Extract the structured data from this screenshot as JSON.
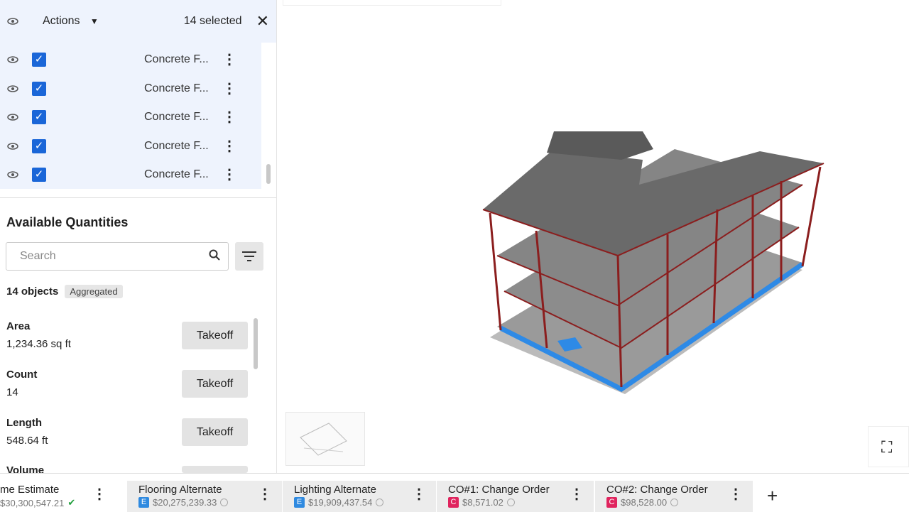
{
  "selection": {
    "actions_label": "Actions",
    "selected_count": "14 selected"
  },
  "rows": [
    {
      "name": "Concrete F..."
    },
    {
      "name": "Concrete F..."
    },
    {
      "name": "Concrete F..."
    },
    {
      "name": "Concrete F..."
    },
    {
      "name": "Concrete F..."
    }
  ],
  "quantities": {
    "title": "Available Quantities",
    "search_placeholder": "Search",
    "objects_count": "14 objects",
    "aggregated_badge": "Aggregated",
    "items": [
      {
        "label": "Area",
        "value": "1,234.36 sq ft",
        "button": "Takeoff"
      },
      {
        "label": "Count",
        "value": "14",
        "button": "Takeoff"
      },
      {
        "label": "Length",
        "value": "548.64 ft",
        "button": "Takeoff"
      },
      {
        "label": "Volume",
        "value": "",
        "button": ""
      }
    ]
  },
  "tabs": [
    {
      "title": "me Estimate",
      "amount": "$30,300,547.21",
      "type": "",
      "status": "complete"
    },
    {
      "title": "Flooring Alternate",
      "amount": "$20,275,239.33",
      "type": "E",
      "status": "pending"
    },
    {
      "title": "Lighting Alternate",
      "amount": "$19,909,437.54",
      "type": "E",
      "status": "pending"
    },
    {
      "title": "CO#1: Change Order",
      "amount": "$8,571.02",
      "type": "C",
      "status": "pending"
    },
    {
      "title": "CO#2: Change Order",
      "amount": "$98,528.00",
      "type": "C",
      "status": "pending"
    }
  ],
  "add_tab_label": "+",
  "colors": {
    "accent": "#1a66d8",
    "estimate": "#2f8ae0",
    "change_order": "#e0245e",
    "success": "#1e9e3a"
  }
}
